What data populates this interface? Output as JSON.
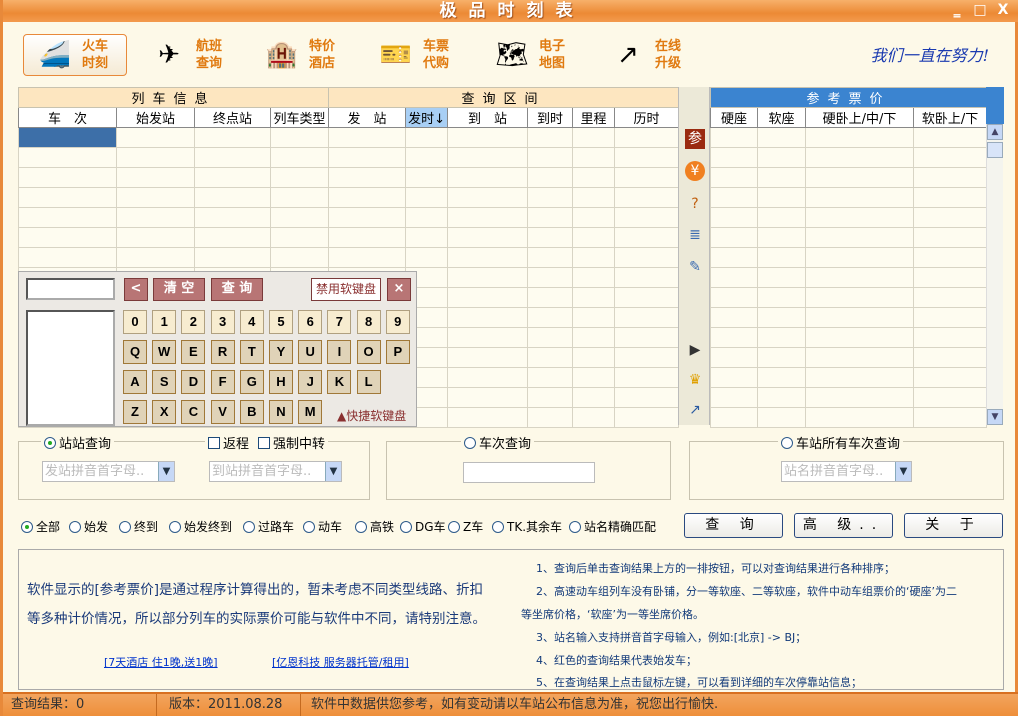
{
  "window": {
    "title": "极品时刻表",
    "minimize": "‗",
    "maximize": "□",
    "close": "X"
  },
  "toolbar": {
    "items": [
      {
        "label1": "火车",
        "label2": "时刻",
        "icon": "train-icon",
        "glyph": "🚄"
      },
      {
        "label1": "航班",
        "label2": "查询",
        "icon": "airplane-icon",
        "glyph": "✈"
      },
      {
        "label1": "特价",
        "label2": "酒店",
        "icon": "hotel-icon",
        "glyph": "🏨"
      },
      {
        "label1": "车票",
        "label2": "代购",
        "icon": "ticket-icon",
        "glyph": "🎫"
      },
      {
        "label1": "电子",
        "label2": "地图",
        "icon": "china-map-icon",
        "glyph": "🗺"
      },
      {
        "label1": "在线",
        "label2": "升级",
        "icon": "upgrade-arrow-icon",
        "glyph": "↗"
      }
    ],
    "slogan": "我们一直在努力!"
  },
  "grid": {
    "groups": [
      "列车信息",
      "查询区间"
    ],
    "columns": [
      "车　次",
      "始发站",
      "终点站",
      "列车类型",
      "发　站",
      "发时↓",
      "到　站",
      "到时",
      "里程",
      "历时"
    ],
    "price_group": "参考票价",
    "price_columns": [
      "硬座",
      "软座",
      "硬卧上/中/下",
      "软卧上/下"
    ]
  },
  "side_icons": [
    "reference-price-icon",
    "yen-icon",
    "question-box-icon",
    "document-icon",
    "edit-pencil-icon",
    "media-play-icon",
    "crown-icon",
    "shortcut-arrow-icon"
  ],
  "keyboard": {
    "back": "<",
    "clear": "清 空",
    "query": "查 询",
    "disable": "禁用软键盘",
    "close": "×",
    "rows": [
      [
        "0",
        "1",
        "2",
        "3",
        "4",
        "5",
        "6",
        "7",
        "8",
        "9"
      ],
      [
        "Q",
        "W",
        "E",
        "R",
        "T",
        "Y",
        "U",
        "I",
        "O",
        "P"
      ],
      [
        "A",
        "S",
        "D",
        "F",
        "G",
        "H",
        "J",
        "K",
        "L"
      ],
      [
        "Z",
        "X",
        "C",
        "V",
        "B",
        "N",
        "M"
      ]
    ],
    "shortcut": "▲快捷软键盘"
  },
  "search": {
    "station_query": "站站查询",
    "return_trip": "返程",
    "force_transfer": "强制中转",
    "from_placeholder": "发站拼音首字母..",
    "to_placeholder": "到站拼音首字母..",
    "train_query": "车次查询",
    "train_value": "",
    "station_all_query": "车站所有车次查询",
    "station_placeholder": "站名拼音首字母.."
  },
  "filters": [
    "全部",
    "始发",
    "终到",
    "始发终到",
    "过路车",
    "动车",
    "高铁",
    "DG车",
    "Z车",
    "TK.其余车",
    "站名精确匹配"
  ],
  "selected_filter": "全部",
  "buttons": {
    "query": "查 询",
    "advanced": "高 级..",
    "about": "关 于"
  },
  "info": {
    "warning1": "软件显示的[参考票价]是通过程序计算得出的，暂未考虑不同类型线路、折扣",
    "warning2": "等多种计价情况，所以部分列车的实际票价可能与软件中不同，请特别注意。",
    "link1": "[7天酒店 住1晚,送1晚]",
    "link2": "[亿恩科技 服务器托管/租用]",
    "notes": [
      "1、查询后单击查询结果上方的一排按钮，可以对查询结果进行各种排序；",
      "2、高速动车组列车没有卧铺，分一等软座、二等软座，软件中动车组票价的‘硬座’为二",
      "等坐席价格，‘软座’为一等坐席价格。",
      "3、站名输入支持拼音首字母输入，例如:[北京] -> BJ；",
      "4、红色的查询结果代表始发车；",
      "5、在查询结果上点击鼠标左键，可以看到详细的车次停靠站信息；"
    ]
  },
  "status": {
    "results": "查询结果：0",
    "version": "版本：2011.08.28",
    "message": "软件中数据供您参考，如有变动请以车站公布信息为准，祝您出行愉快."
  },
  "colors": {
    "accent": "#ec8a35",
    "price_header": "#3b84d0",
    "selected_row": "#3d6fa8"
  }
}
